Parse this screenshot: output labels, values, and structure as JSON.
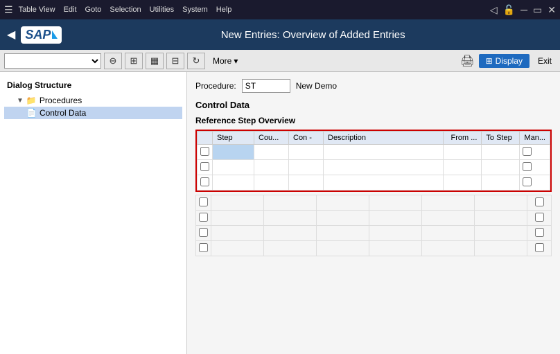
{
  "titlebar": {
    "menus": [
      "Table View",
      "Edit",
      "Goto",
      "Selection",
      "Utilities",
      "System",
      "Help"
    ]
  },
  "header": {
    "back_label": "◀",
    "logo_text": "SAP",
    "title": "New Entries: Overview of Added Entries"
  },
  "toolbar": {
    "select_placeholder": "",
    "more_label": "More",
    "display_label": "Display",
    "exit_label": "Exit"
  },
  "sidebar": {
    "title": "Dialog Structure",
    "items": [
      {
        "label": "Procedures",
        "indent": 1,
        "type": "folder",
        "expanded": true
      },
      {
        "label": "Control Data",
        "indent": 2,
        "type": "node",
        "selected": true
      }
    ]
  },
  "content": {
    "procedure_label": "Procedure:",
    "procedure_value": "ST",
    "procedure_name": "New Demo",
    "section_title": "Control Data",
    "subsection_title": "Reference Step Overview",
    "table": {
      "columns": [
        {
          "key": "check",
          "label": ""
        },
        {
          "key": "step",
          "label": "Step"
        },
        {
          "key": "cou",
          "label": "Cou..."
        },
        {
          "key": "con",
          "label": "Con -"
        },
        {
          "key": "desc",
          "label": "Description"
        },
        {
          "key": "from",
          "label": "From ..."
        },
        {
          "key": "tostep",
          "label": "To Step"
        },
        {
          "key": "man",
          "label": "Man..."
        }
      ],
      "rows": [
        {
          "check": false,
          "step": "",
          "cou": "",
          "con": "",
          "desc": "",
          "from": "",
          "tostep": "",
          "man": false,
          "selected": true
        },
        {
          "check": false,
          "step": "",
          "cou": "",
          "con": "",
          "desc": "",
          "from": "",
          "tostep": "",
          "man": false
        },
        {
          "check": false,
          "step": "",
          "cou": "",
          "con": "",
          "desc": "",
          "from": "",
          "tostep": "",
          "man": false
        }
      ]
    },
    "extra_rows": [
      {
        "check": false,
        "man": false
      },
      {
        "check": false,
        "man": false
      },
      {
        "check": false,
        "man": false
      },
      {
        "check": false,
        "man": false
      }
    ]
  }
}
